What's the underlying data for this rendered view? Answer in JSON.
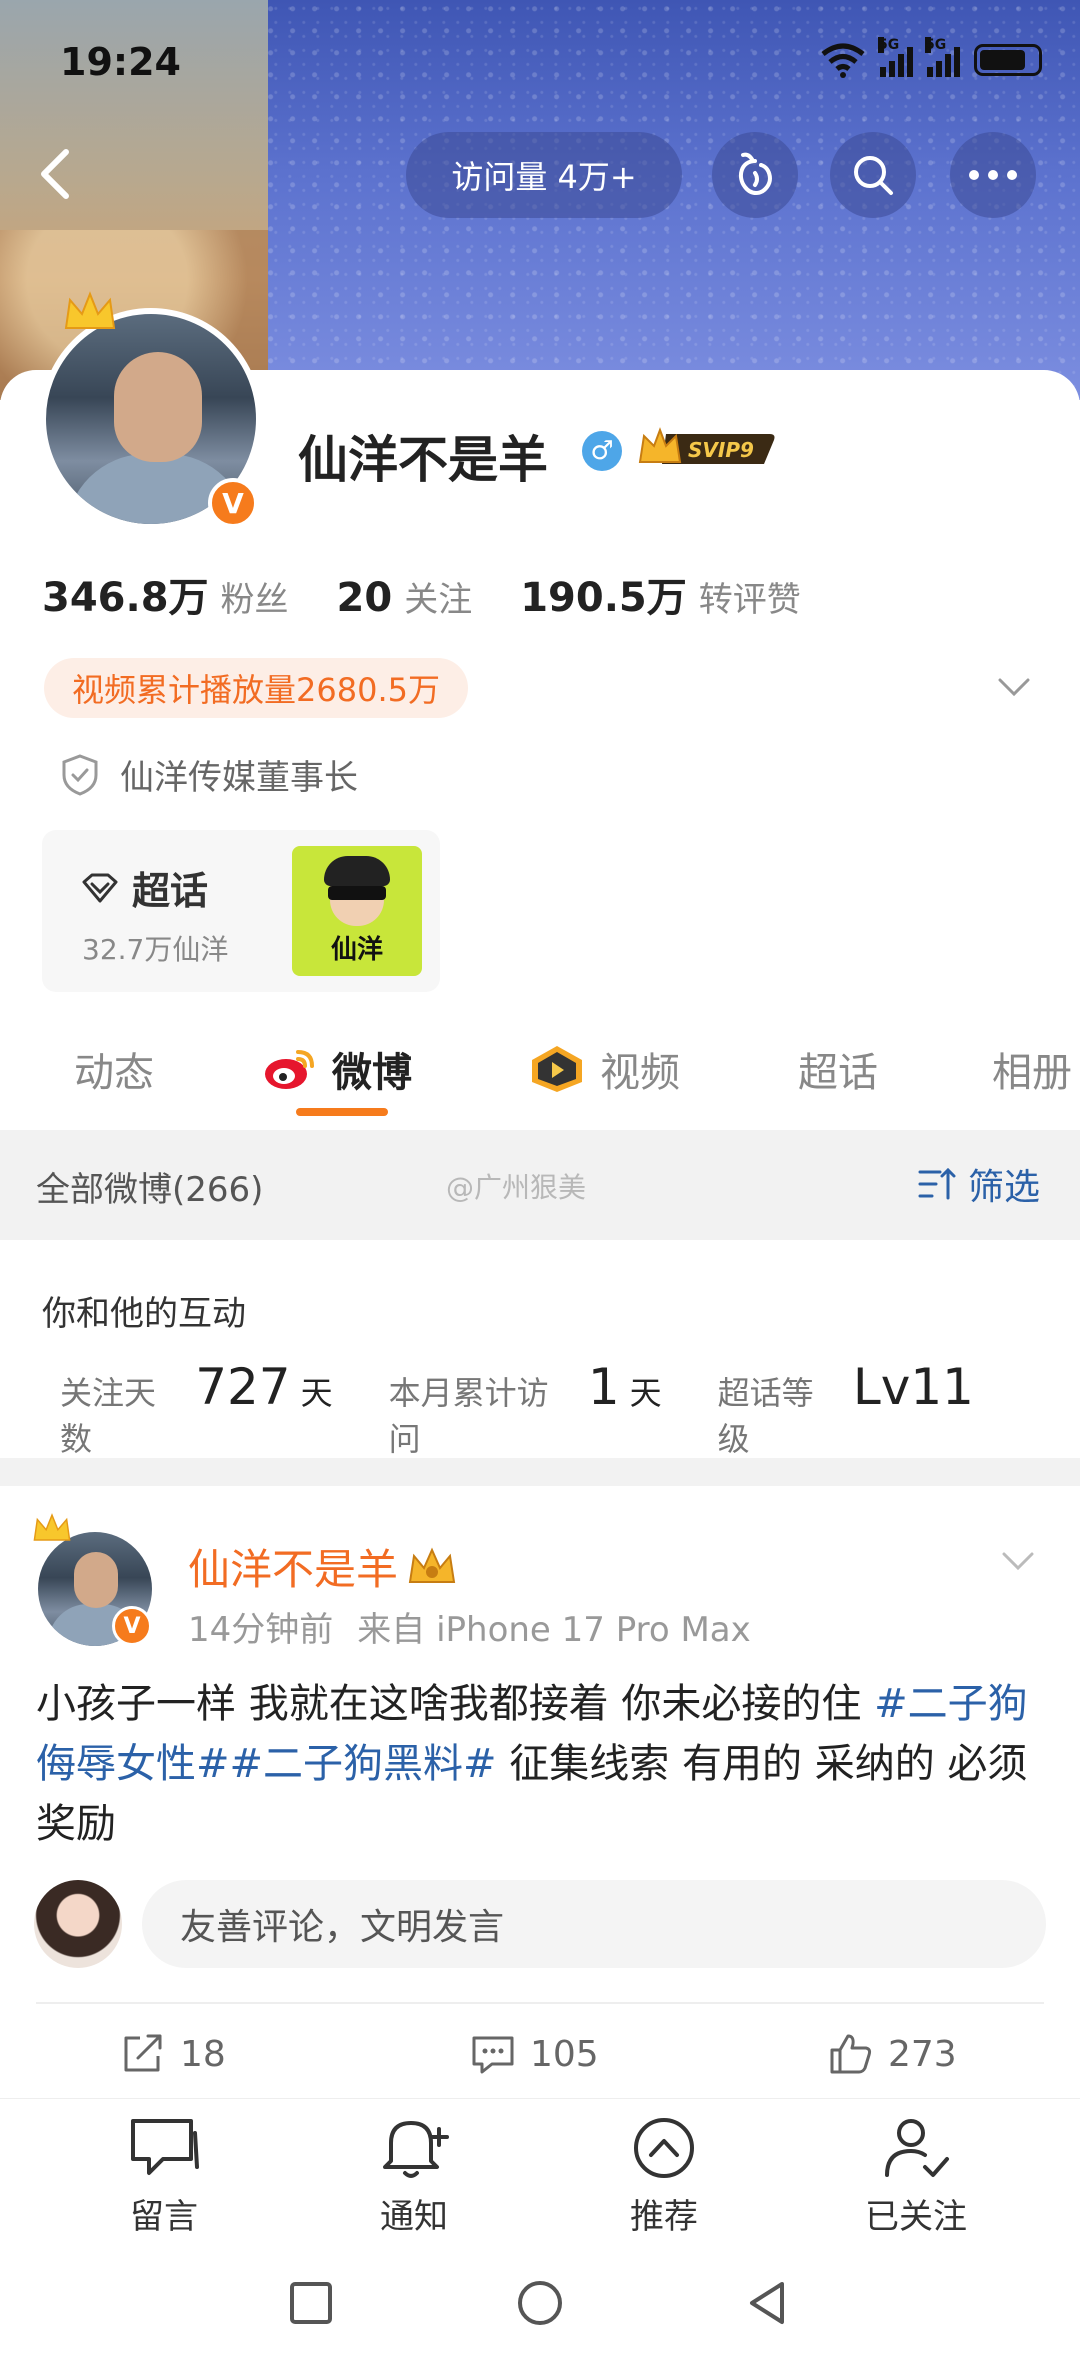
{
  "status_bar": {
    "time": "19:24",
    "network_1": "5G",
    "network_2": "5G"
  },
  "top_nav": {
    "visits_label": "访问量 4万+"
  },
  "profile": {
    "name": "仙洋不是羊",
    "svip_label": "SVIP9",
    "gender_symbol": "♂",
    "verified_mark": "V",
    "stats": [
      {
        "value": "346.8万",
        "label": "粉丝"
      },
      {
        "value": "20",
        "label": "关注"
      },
      {
        "value": "190.5万",
        "label": "转评赞"
      }
    ],
    "play_count_label": "视频累计播放量2680.5万",
    "certification": "仙洋传媒董事长",
    "chaohua": {
      "title": "超话",
      "subtitle": "32.7万仙洋",
      "thumb_text": "仙洋"
    }
  },
  "tabs": [
    {
      "label": "动态"
    },
    {
      "label": "微博",
      "active": true
    },
    {
      "label": "视频"
    },
    {
      "label": "超话"
    },
    {
      "label": "相册"
    }
  ],
  "filter_bar": {
    "all_posts": "全部微博(266)",
    "watermark": "@广州狠美",
    "filter_label": "筛选"
  },
  "interaction": {
    "title": "你和他的互动",
    "items": [
      {
        "label": "关注天数",
        "value": "727",
        "unit": "天"
      },
      {
        "label": "本月累计访问",
        "value": "1",
        "unit": "天"
      },
      {
        "label": "超话等级",
        "value": "Lv11",
        "unit": ""
      }
    ]
  },
  "post": {
    "author": "仙洋不是羊",
    "time": "14分钟前",
    "source": "来自 iPhone 17 Pro Max",
    "text_part1": "小孩子一样 我就在这啥我都接着 你未必接的住 ",
    "topic1": "#二子狗侮辱女性#",
    "topic2": "#二子狗黑料#",
    "text_part2": " 征集线索 有用的 采纳的 必须奖励",
    "comment_placeholder": "友善评论，文明发言",
    "reposts": "18",
    "comments": "105",
    "likes": "273"
  },
  "bottom_bar": [
    {
      "label": "留言"
    },
    {
      "label": "通知"
    },
    {
      "label": "推荐"
    },
    {
      "label": "已关注"
    }
  ],
  "colors": {
    "accent": "#f67b1c",
    "link": "#2b61a8",
    "verified_blue": "#4ea6e8"
  }
}
